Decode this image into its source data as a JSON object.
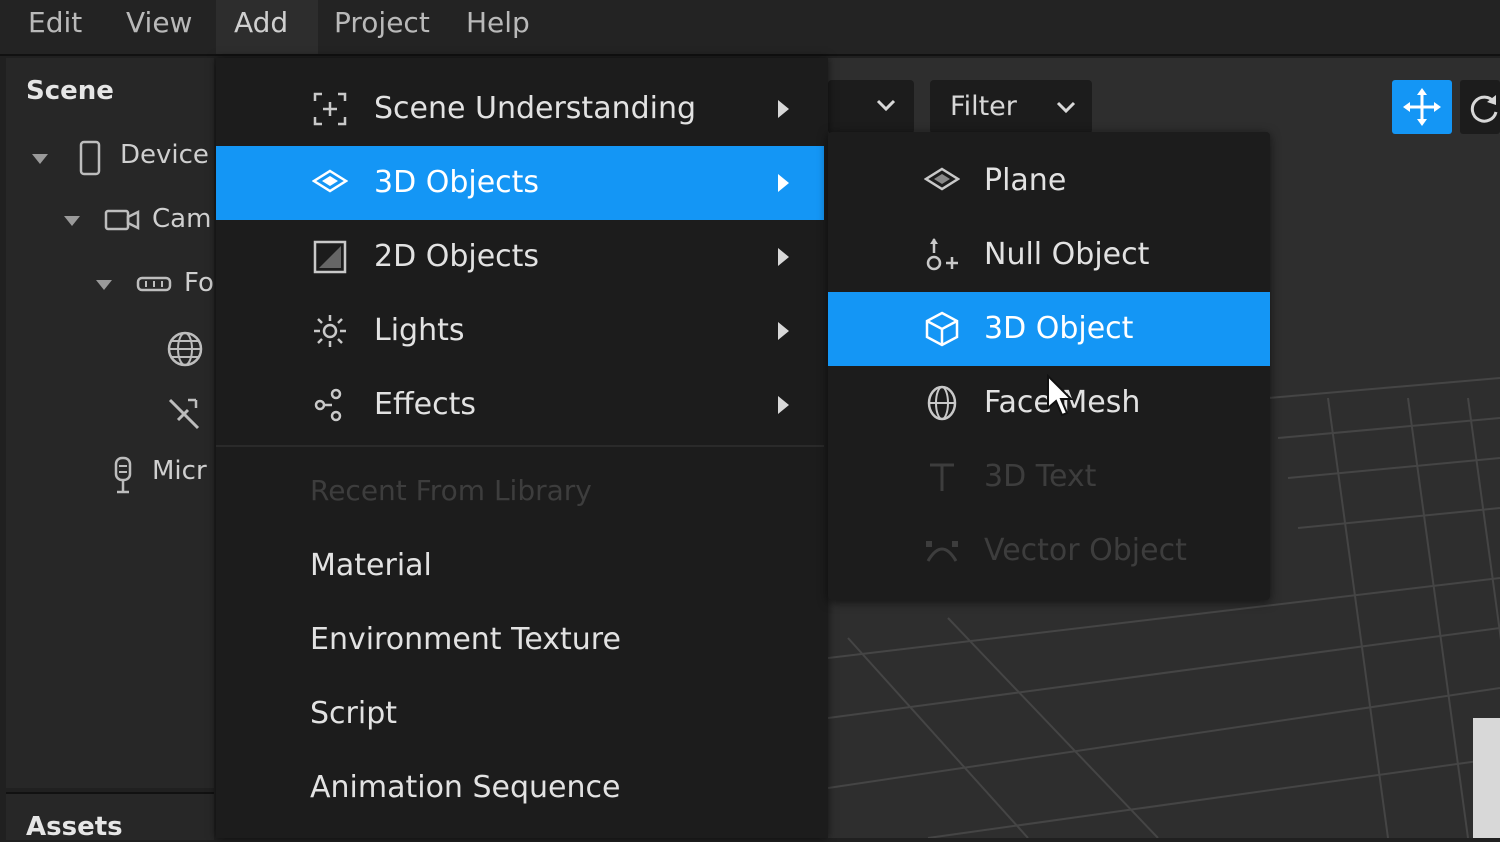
{
  "menubar": {
    "items": [
      {
        "label": "Edit"
      },
      {
        "label": "View"
      },
      {
        "label": "Add"
      },
      {
        "label": "Project"
      },
      {
        "label": "Help"
      }
    ]
  },
  "scene_panel": {
    "title": "Scene",
    "tree": [
      {
        "label": "Device",
        "icon": "device-icon"
      },
      {
        "label": "Cam",
        "icon": "camera-icon"
      },
      {
        "label": "Fo",
        "icon": "face-tracker-icon"
      },
      {
        "label": "",
        "icon": "globe-icon"
      },
      {
        "label": "",
        "icon": "effect-icon"
      },
      {
        "label": "Micr",
        "icon": "microphone-icon"
      }
    ]
  },
  "assets_panel": {
    "title": "Assets"
  },
  "viewport_toolbar": {
    "filter_label": "Filter"
  },
  "add_menu": {
    "items": [
      {
        "label": "Scene Understanding",
        "icon": "scene-understanding-icon",
        "submenu": true
      },
      {
        "label": "3D Objects",
        "icon": "3d-objects-icon",
        "submenu": true,
        "highlighted": true
      },
      {
        "label": "2D Objects",
        "icon": "2d-objects-icon",
        "submenu": true
      },
      {
        "label": "Lights",
        "icon": "light-icon",
        "submenu": true
      },
      {
        "label": "Effects",
        "icon": "effects-icon",
        "submenu": true
      }
    ],
    "recent_header": "Recent From Library",
    "recent_items": [
      {
        "label": "Material"
      },
      {
        "label": "Environment Texture"
      },
      {
        "label": "Script"
      },
      {
        "label": "Animation Sequence"
      }
    ]
  },
  "submenu_3d": {
    "items": [
      {
        "label": "Plane",
        "icon": "plane-icon"
      },
      {
        "label": "Null Object",
        "icon": "null-object-icon"
      },
      {
        "label": "3D Object",
        "icon": "cube-icon",
        "highlighted": true
      },
      {
        "label": "Face Mesh",
        "icon": "face-mesh-icon"
      },
      {
        "label": "3D Text",
        "icon": "text-icon",
        "disabled": true
      },
      {
        "label": "Vector Object",
        "icon": "vector-object-icon",
        "disabled": true
      }
    ]
  },
  "colors": {
    "accent": "#1496f5",
    "menu_bg": "#1c1c1c",
    "panel_bg": "#272727"
  }
}
